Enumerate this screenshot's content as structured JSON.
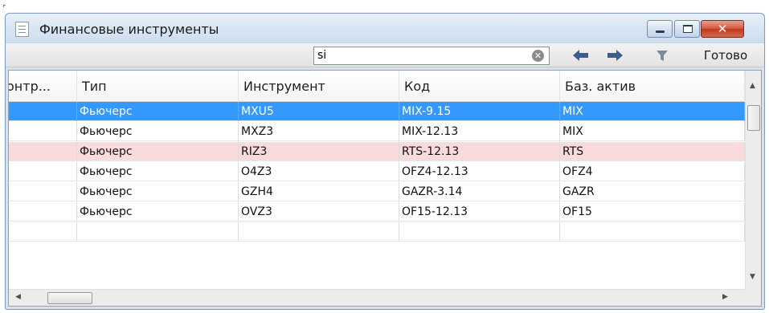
{
  "window": {
    "title": "Финансовые инструменты",
    "controls": {
      "minimize": "minimize",
      "maximize": "maximize",
      "close": "close"
    }
  },
  "toolbar": {
    "search_value": "si",
    "done_label": "Готово",
    "icons": [
      "clear-icon",
      "arrow-left-icon",
      "arrow-right-icon",
      "filter-icon"
    ]
  },
  "grid": {
    "columns": [
      "онтр...",
      "Тип",
      "Инструмент",
      "Код",
      "Баз. актив"
    ],
    "rows": [
      {
        "contr": "",
        "type": "Фьючерс",
        "instrument": "MXU5",
        "code": "MIX-9.15",
        "base": "MIX",
        "state": "selected"
      },
      {
        "contr": "",
        "type": "Фьючерс",
        "instrument": "MXZ3",
        "code": "MIX-12.13",
        "base": "MIX",
        "state": "normal"
      },
      {
        "contr": "",
        "type": "Фьючерс",
        "instrument": "RIZ3",
        "code": "RTS-12.13",
        "base": "RTS",
        "state": "alert"
      },
      {
        "contr": "",
        "type": "Фьючерс",
        "instrument": "O4Z3",
        "code": "OFZ4-12.13",
        "base": "OFZ4",
        "state": "normal"
      },
      {
        "contr": "",
        "type": "Фьючерс",
        "instrument": "GZH4",
        "code": "GAZR-3.14",
        "base": "GAZR",
        "state": "normal"
      },
      {
        "contr": "",
        "type": "Фьючерс",
        "instrument": "OVZ3",
        "code": "OF15-12.13",
        "base": "OF15",
        "state": "normal"
      },
      {
        "contr": "",
        "type": "",
        "instrument": "",
        "code": "",
        "base": "",
        "state": "normal"
      }
    ]
  },
  "colors": {
    "selection": "#3399ff",
    "alert_row": "#fadbdc",
    "close_button": "#c0391f"
  }
}
